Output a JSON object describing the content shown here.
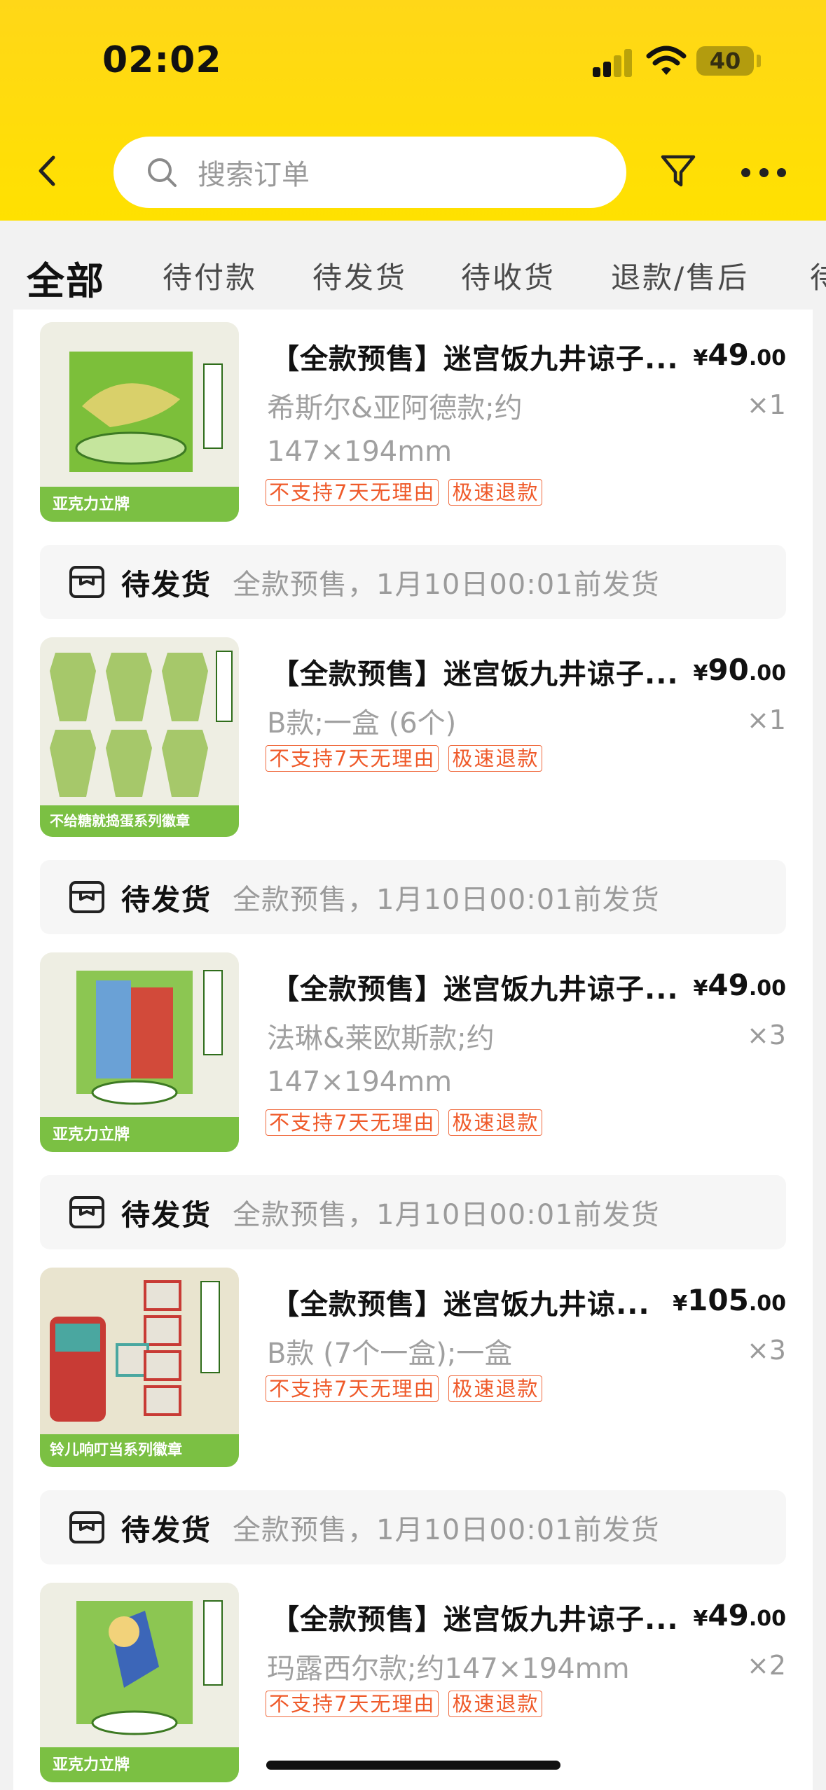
{
  "status_bar": {
    "time": "02:02",
    "battery": "40"
  },
  "header": {
    "search_placeholder": "搜索订单",
    "icons": [
      "chevron-left-icon",
      "search-icon",
      "filter-icon",
      "more-dots-icon"
    ]
  },
  "tabs": [
    {
      "label": "全部",
      "active": true
    },
    {
      "label": "待付款"
    },
    {
      "label": "待发货"
    },
    {
      "label": "待收货"
    },
    {
      "label": "退款/售后"
    },
    {
      "label": "待"
    }
  ],
  "colors": {
    "header_yellow": "#ffde00",
    "tag_orange": "#ef5a2a",
    "background": "#f2f2f2"
  },
  "orders": [
    {
      "item": {
        "title": "【全款预售】迷宫饭九井谅子...",
        "price_currency": "¥",
        "price_int": "49",
        "price_dec": ".00",
        "spec": "希斯尔&亚阿德款;约147×194mm",
        "qty": "×1",
        "tags": [
          "不支持7天无理由",
          "极速退款"
        ],
        "thumb_caption": "亚克力立牌"
      }
    },
    {
      "status": {
        "label": "待发货",
        "desc": "全款预售，1月10日00:01前发货"
      },
      "item": {
        "title": "【全款预售】迷宫饭九井谅子...",
        "price_currency": "¥",
        "price_int": "90",
        "price_dec": ".00",
        "spec": "B款;一盒 (6个)",
        "qty": "×1",
        "tags": [
          "不支持7天无理由",
          "极速退款"
        ],
        "thumb_caption": "不给糖就捣蛋系列徽章"
      }
    },
    {
      "status": {
        "label": "待发货",
        "desc": "全款预售，1月10日00:01前发货"
      },
      "item": {
        "title": "【全款预售】迷宫饭九井谅子...",
        "price_currency": "¥",
        "price_int": "49",
        "price_dec": ".00",
        "spec": "法琳&莱欧斯款;约147×194mm",
        "qty": "×3",
        "tags": [
          "不支持7天无理由",
          "极速退款"
        ],
        "thumb_caption": "亚克力立牌"
      }
    },
    {
      "status": {
        "label": "待发货",
        "desc": "全款预售，1月10日00:01前发货"
      },
      "item": {
        "title": "【全款预售】迷宫饭九井谅...",
        "price_currency": "¥",
        "price_int": "105",
        "price_dec": ".00",
        "spec": "B款 (7个一盒);一盒",
        "qty": "×3",
        "tags": [
          "不支持7天无理由",
          "极速退款"
        ],
        "thumb_caption": "铃儿响叮当系列徽章"
      }
    },
    {
      "status": {
        "label": "待发货",
        "desc": "全款预售，1月10日00:01前发货"
      },
      "item": {
        "title": "【全款预售】迷宫饭九井谅子...",
        "price_currency": "¥",
        "price_int": "49",
        "price_dec": ".00",
        "spec": "玛露西尔款;约147×194mm",
        "qty": "×2",
        "tags": [
          "不支持7天无理由",
          "极速退款"
        ],
        "thumb_caption": "亚克力立牌"
      }
    }
  ]
}
